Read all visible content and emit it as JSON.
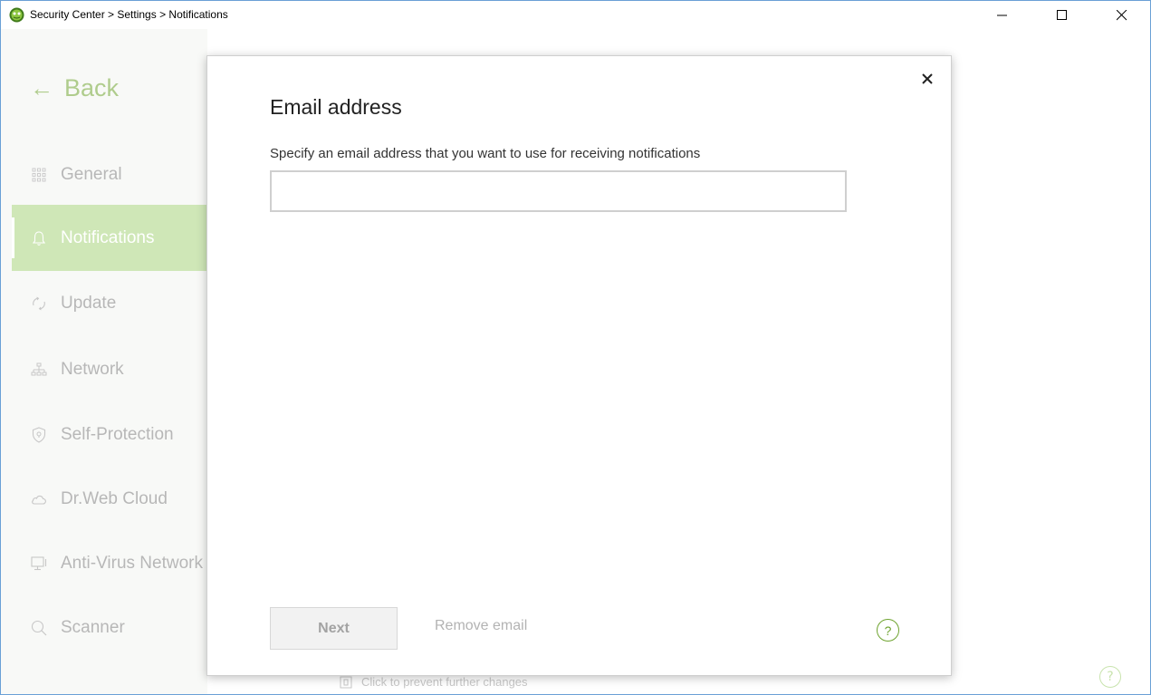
{
  "window": {
    "title": "Security Center > Settings > Notifications",
    "app_icon": "drweb-spider-icon"
  },
  "sidebar": {
    "back_label": "Back",
    "items": [
      {
        "label": "General",
        "icon": "grid-icon",
        "active": false
      },
      {
        "label": "Notifications",
        "icon": "bell-icon",
        "active": true
      },
      {
        "label": "Update",
        "icon": "refresh-icon",
        "active": false
      },
      {
        "label": "Network",
        "icon": "network-icon",
        "active": false
      },
      {
        "label": "Self-Protection",
        "icon": "shield-icon",
        "active": false
      },
      {
        "label": "Dr.Web Cloud",
        "icon": "cloud-icon",
        "active": false
      },
      {
        "label": "Anti-Virus Network",
        "icon": "monitor-icon",
        "active": false
      },
      {
        "label": "Scanner",
        "icon": "search-icon",
        "active": false
      }
    ]
  },
  "background": {
    "lock_text": "Click to prevent further changes",
    "help_label": "?"
  },
  "dialog": {
    "title": "Email address",
    "description": "Specify an email address that you want to use for receiving notifications",
    "email_value": "",
    "next_label": "Next",
    "remove_label": "Remove email",
    "help_label": "?",
    "close_icon": "close-icon"
  },
  "colors": {
    "accent": "#6ea32f",
    "active_item": "#a8d37c",
    "sidebar_bg": "#f3f4f1"
  }
}
